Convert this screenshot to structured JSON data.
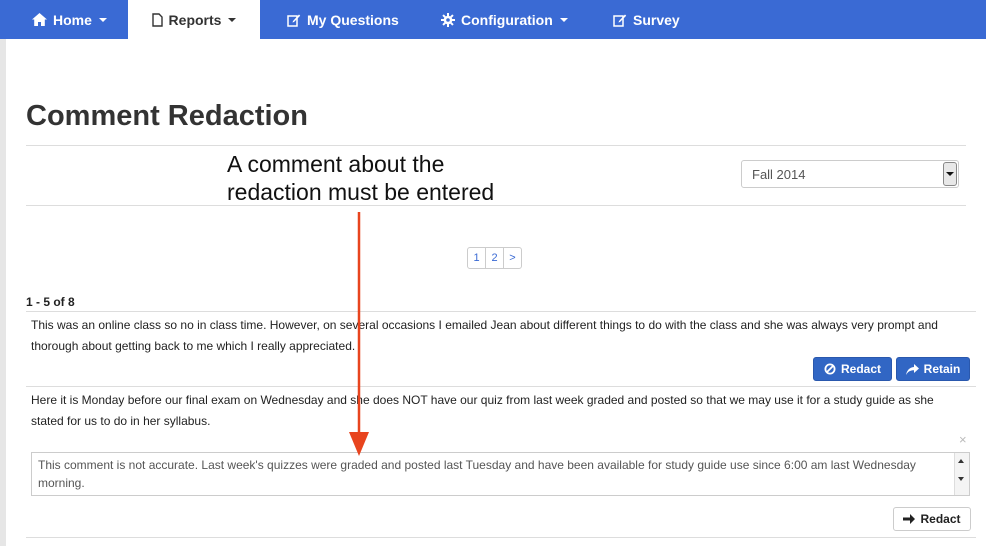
{
  "nav": {
    "home": "Home",
    "reports": "Reports",
    "my_questions": "My Questions",
    "configuration": "Configuration",
    "survey": "Survey"
  },
  "page": {
    "title": "Comment Redaction",
    "annotation": "A comment about the\nredaction must be entered",
    "term": "Fall 2014"
  },
  "pagination": {
    "pages": [
      "1",
      "2"
    ],
    "next": ">"
  },
  "range_label": "1 - 5 of 8",
  "comments": [
    {
      "text": "This was an online class so no in class time. However, on several occasions I emailed Jean about different things to do with the class and she was always very prompt and thorough about getting back to me which I really appreciated.",
      "redact_label": "Redact",
      "retain_label": "Retain"
    },
    {
      "text": "Here it is Monday before our final exam on Wednesday and she does NOT have our quiz from last week graded and posted so that we may use it for a study guide as she stated for us to do in her syllabus.",
      "reason_text": "This comment is not accurate. Last week's quizzes were graded and posted last Tuesday and have been available for study guide use since 6:00 am last Wednesday morning.",
      "close_symbol": "×",
      "redact_label": "Redact"
    }
  ],
  "colors": {
    "nav_bg": "#3a6ad4",
    "primary_btn": "#3166c4",
    "annotation_arrow": "#e8441e"
  }
}
